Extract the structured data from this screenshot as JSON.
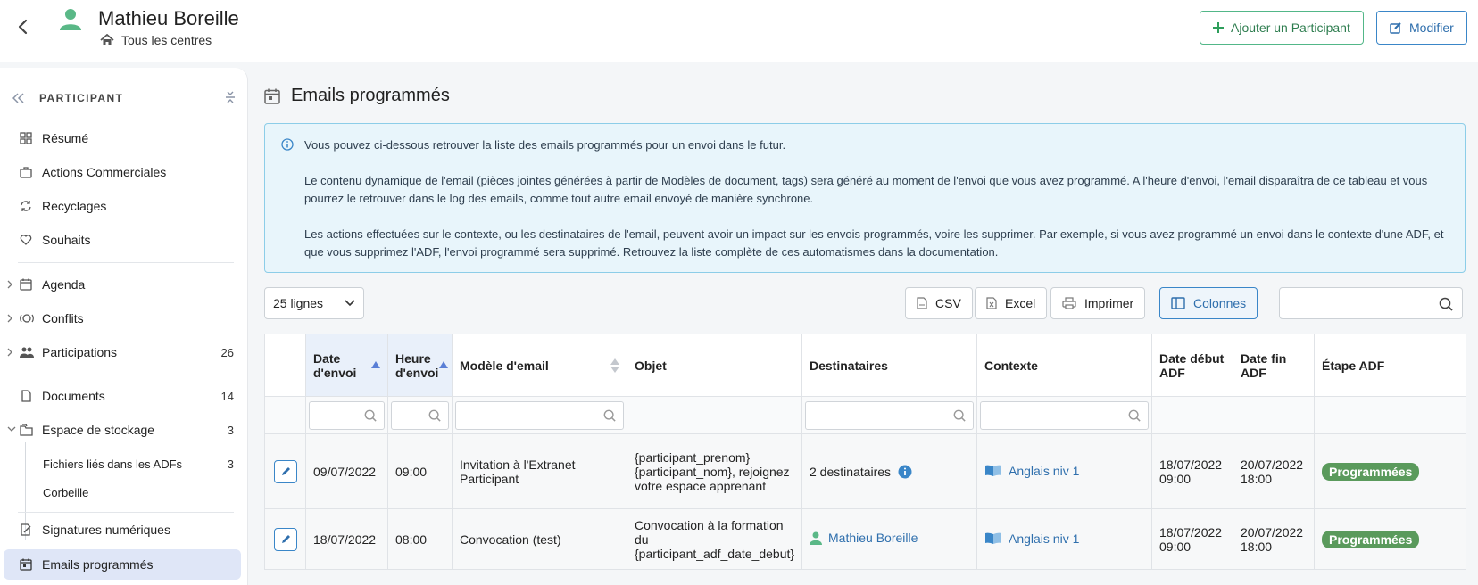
{
  "header": {
    "title": "Mathieu Boreille",
    "subtitle": "Tous les centres",
    "add_label": "Ajouter un Participant",
    "edit_label": "Modifier"
  },
  "sidebar": {
    "heading": "PARTICIPANT",
    "items": [
      {
        "label": "Résumé"
      },
      {
        "label": "Actions Commerciales"
      },
      {
        "label": "Recyclages"
      },
      {
        "label": "Souhaits"
      },
      {
        "label": "Agenda"
      },
      {
        "label": "Conflits"
      },
      {
        "label": "Participations",
        "count": "26"
      },
      {
        "label": "Documents",
        "count": "14"
      },
      {
        "label": "Espace de stockage",
        "count": "3"
      },
      {
        "label": "Fichiers liés dans les ADFs",
        "count": "3"
      },
      {
        "label": "Corbeille"
      },
      {
        "label": "Signatures numériques"
      },
      {
        "label": "Emails programmés"
      }
    ]
  },
  "main": {
    "title": "Emails programmés",
    "info": [
      "Vous pouvez ci-dessous retrouver la liste des emails programmés pour un envoi dans le futur.",
      "Le contenu dynamique de l'email (pièces jointes générées à partir de Modèles de document, tags) sera généré au moment de l'envoi que vous avez programmé. A l'heure d'envoi, l'email disparaîtra de ce tableau et vous pourrez le retrouver dans le log des emails, comme tout autre email envoyé de manière synchrone.",
      "Les actions effectuées sur le contexte, ou les destinataires de l'email, peuvent avoir un impact sur les envois programmés, voire les supprimer. Par exemple, si vous avez programmé un envoi dans le contexte d'une ADF, et que vous supprimez l'ADF, l'envoi programmé sera supprimé. Retrouvez la liste complète de ces automatismes dans la documentation."
    ],
    "lines_select": "25 lignes",
    "buttons": {
      "csv": "CSV",
      "excel": "Excel",
      "print": "Imprimer",
      "columns": "Colonnes"
    }
  },
  "table": {
    "headers": [
      "Date d'envoi",
      "Heure d'envoi",
      "Modèle d'email",
      "Objet",
      "Destinataires",
      "Contexte",
      "Date début ADF",
      "Date fin ADF",
      "Étape ADF"
    ],
    "rows": [
      {
        "date": "09/07/2022",
        "heure": "09:00",
        "modele": "Invitation à l'Extranet Participant",
        "objet": "{participant_prenom} {participant_nom}, rejoignez votre espace apprenant",
        "destinataires": "2 destinataires",
        "contexte": "Anglais niv 1",
        "debut": "18/07/2022 09:00",
        "fin": "20/07/2022 18:00",
        "etape": "Programmées"
      },
      {
        "date": "18/07/2022",
        "heure": "08:00",
        "modele": "Convocation (test)",
        "objet": "Convocation à la formation du {participant_adf_date_debut}",
        "destinataires": "Mathieu Boreille",
        "contexte": "Anglais niv 1",
        "debut": "18/07/2022 09:00",
        "fin": "20/07/2022 18:00",
        "etape": "Programmées"
      }
    ]
  }
}
